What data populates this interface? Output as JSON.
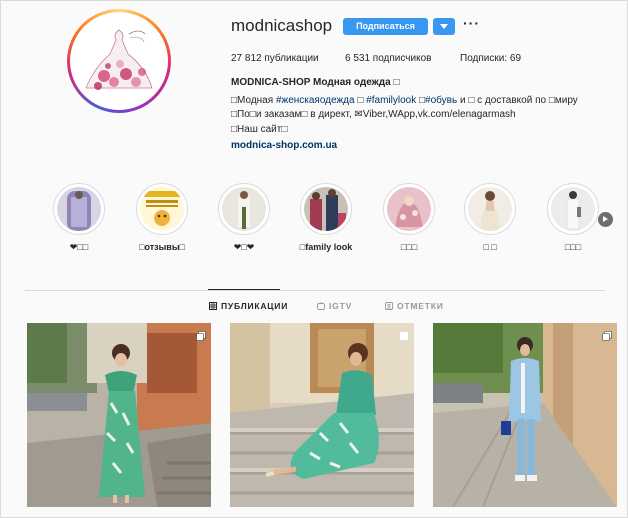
{
  "profile": {
    "username": "modnicashop",
    "follow_label": "Подписаться",
    "more_icon": "more-dots-icon",
    "stats": {
      "posts": "27 812 публикации",
      "followers": "6 531 подписчиков",
      "following": "Подписки: 69"
    },
    "bio": {
      "name": "MODNICA-SHOP Модная одежда □",
      "line1_prefix": "□Модная ",
      "line1_tag1": "#женскаяодежда",
      "line1_mid": " □ ",
      "line1_tag2": "#familylook",
      "line1_mid2": " □",
      "line1_tag3": "#обувь",
      "line1_suffix": " и □ с доставкой по □миру",
      "line2": "□По□и заказам□ в директ, ✉Viber,WApp,vk.com/elenagarmash",
      "line3": "□Наш сайт□",
      "link": "modnica-shop.com.ua"
    }
  },
  "highlights": [
    {
      "label": "❤□□"
    },
    {
      "label": "□отзывы□"
    },
    {
      "label": "❤□❤"
    },
    {
      "label": "□family look"
    },
    {
      "label": "□□□"
    },
    {
      "label": "□ □"
    },
    {
      "label": "□□□"
    }
  ],
  "tabs": [
    {
      "label": "ПУБЛИКАЦИИ",
      "icon": "grid-icon",
      "active": true
    },
    {
      "label": "IGTV",
      "icon": "igtv-icon",
      "active": false
    },
    {
      "label": "ОТМЕТКИ",
      "icon": "tagged-icon",
      "active": false
    }
  ],
  "posts": [
    {
      "badge_icon": "carousel-icon"
    },
    {
      "badge_icon": "carousel-icon"
    },
    {
      "badge_icon": "carousel-icon"
    }
  ],
  "colors": {
    "accent": "#3897f0",
    "link": "#003569",
    "text": "#262626",
    "muted": "#999999"
  }
}
